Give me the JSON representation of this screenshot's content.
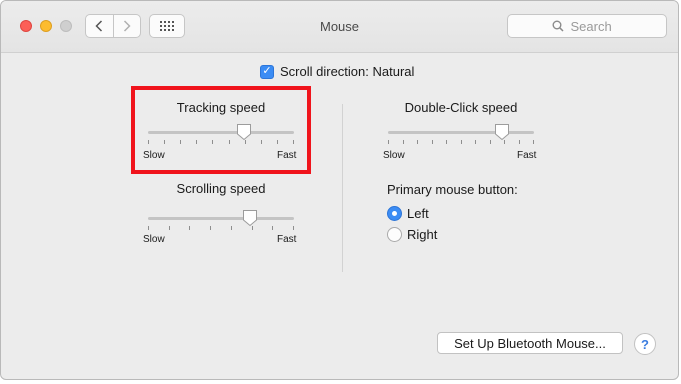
{
  "window": {
    "title": "Mouse"
  },
  "toolbar": {
    "back_icon": "chevron-left-icon",
    "forward_icon": "chevron-right-icon",
    "grid_icon": "show-all-grid-icon",
    "search_placeholder": "Search",
    "search_value": ""
  },
  "scroll_direction": {
    "label": "Scroll direction: Natural",
    "checked": true
  },
  "tracking_speed": {
    "title": "Tracking speed",
    "min_label": "Slow",
    "max_label": "Fast",
    "value": 0.66,
    "ticks": 10
  },
  "scrolling_speed": {
    "title": "Scrolling speed",
    "min_label": "Slow",
    "max_label": "Fast",
    "value": 0.7,
    "ticks": 8
  },
  "double_click_speed": {
    "title": "Double-Click speed",
    "min_label": "Slow",
    "max_label": "Fast",
    "value": 0.78,
    "ticks": 11
  },
  "primary_button": {
    "label": "Primary mouse button:",
    "options": [
      {
        "label": "Left",
        "selected": true
      },
      {
        "label": "Right",
        "selected": false
      }
    ]
  },
  "bluetooth_button": {
    "label": "Set Up Bluetooth Mouse..."
  },
  "help_button": {
    "label": "?"
  },
  "colors": {
    "accent": "#3b8cf4",
    "highlight": "#f0141c"
  }
}
